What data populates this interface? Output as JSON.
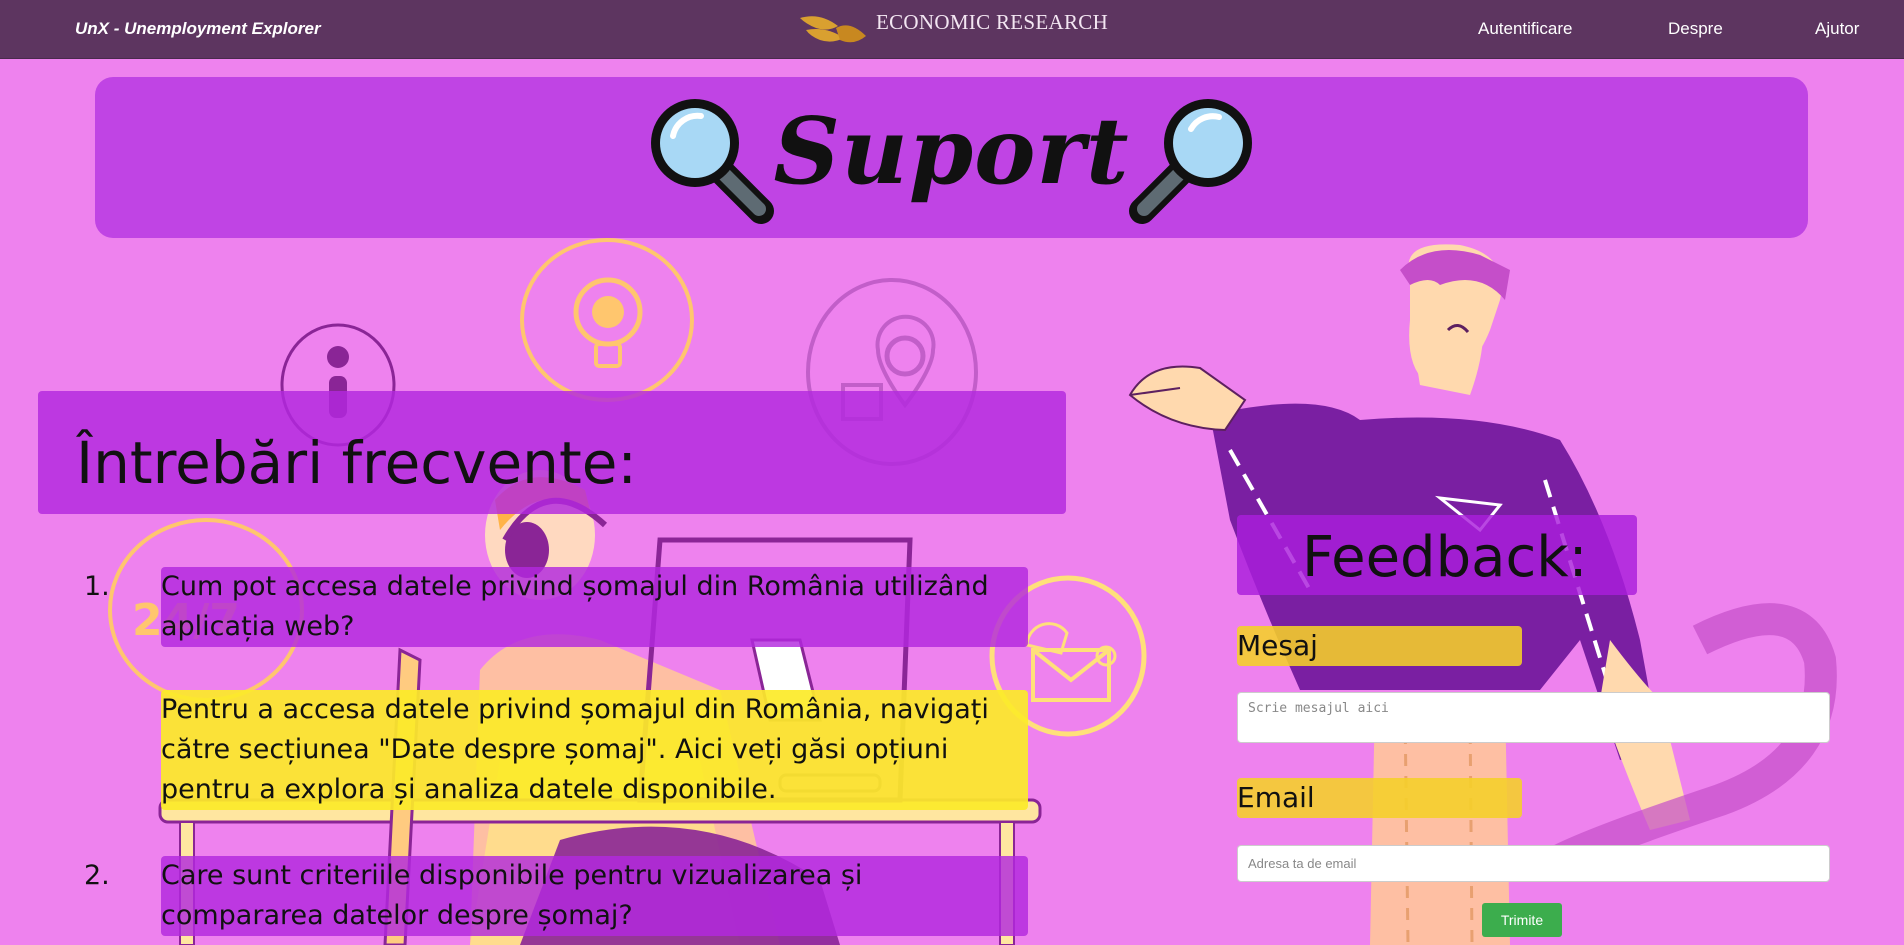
{
  "navbar": {
    "brand": "UnX - Unemployment Explorer",
    "logo_text": "ECONOMIC RESEARCH",
    "links": [
      "Autentificare",
      "Despre",
      "Ajutor"
    ]
  },
  "banner": {
    "title": "Suport"
  },
  "faq": {
    "title": "Întrebări frecvente:",
    "items": [
      {
        "number": "1.",
        "question": "Cum pot accesa datele privind șomajul din România utilizând aplicația web?",
        "answer": "Pentru a accesa datele privind șomajul din România, navigați către secțiunea \"Date despre șomaj\". Aici veți găsi opțiuni pentru a explora și analiza datele disponibile."
      },
      {
        "number": "2.",
        "question": "Care sunt criteriile disponibile pentru vizualizarea și compararea datelor despre șomaj?"
      }
    ]
  },
  "feedback": {
    "title": "Feedback:",
    "message_label": "Mesaj",
    "message_placeholder": "Scrie mesajul aici",
    "email_label": "Email",
    "email_placeholder": "Adresa ta de email",
    "submit_label": "Trimite"
  },
  "colors": {
    "navbar": "#5d3560",
    "page_background": "#ee82ee",
    "banner": "#c044e4",
    "question_box": "#b228de",
    "answer_box": "#fcea28",
    "submit_button": "#3cad4d"
  }
}
